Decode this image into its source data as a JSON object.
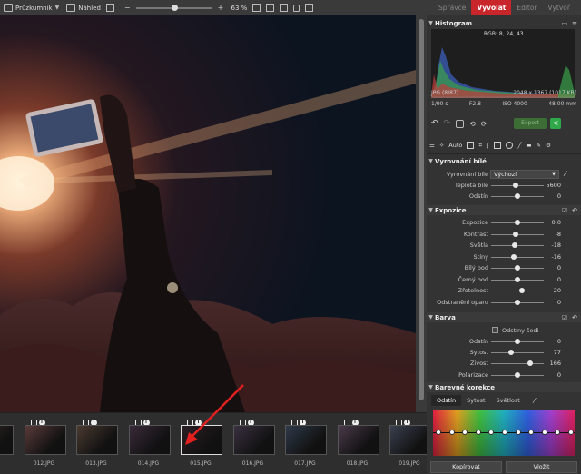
{
  "toolbar": {
    "browser_label": "Průzkumník",
    "preview_label": "Náhled",
    "zoom": "63 %",
    "zoom_slider": 0.5
  },
  "tabs": [
    {
      "label": "Správce",
      "active": false
    },
    {
      "label": "Vyvolat",
      "active": true
    },
    {
      "label": "Editor",
      "active": false
    },
    {
      "label": "Vytvoř",
      "active": false
    }
  ],
  "histogram": {
    "title": "Histogram",
    "rgb": "RGB: 8, 24, 43",
    "format_index": "JPG  (8/87)",
    "dimensions": "2048 x 1367 (1017 KB)",
    "shutter": "1/90 s",
    "aperture": "F2.8",
    "iso": "ISO 4000",
    "focal": "48.00 mm"
  },
  "export_label": "Export",
  "icon_row": {
    "auto_label": "Auto"
  },
  "white_balance": {
    "title": "Vyrovnání bílé",
    "rows": [
      {
        "label": "Vyrovnání bílé",
        "value": "Výchozí"
      },
      {
        "label": "Teplota bílé",
        "value": "5600",
        "level": 0.46
      },
      {
        "label": "Odstín",
        "value": "0",
        "level": 0.5
      }
    ]
  },
  "exposure": {
    "title": "Expozice",
    "rows": [
      {
        "label": "Expozice",
        "value": "0.0",
        "level": 0.5
      },
      {
        "label": "Kontrast",
        "value": "-8",
        "level": 0.46
      },
      {
        "label": "Světla",
        "value": "-18",
        "level": 0.44
      },
      {
        "label": "Stíny",
        "value": "-16",
        "level": 0.43
      },
      {
        "label": "Bílý bod",
        "value": "0",
        "level": 0.5
      },
      {
        "label": "Černý bod",
        "value": "0",
        "level": 0.5
      },
      {
        "label": "Zřetelnost",
        "value": "20",
        "level": 0.58
      },
      {
        "label": "Odstranění oparu",
        "value": "0",
        "level": 0.5
      }
    ]
  },
  "color": {
    "title": "Barva",
    "grayscale_label": "Odstíny šedi",
    "rows": [
      {
        "label": "Odstín",
        "value": "0",
        "level": 0.5
      },
      {
        "label": "Sytost",
        "value": "77",
        "level": 0.38
      },
      {
        "label": "Živost",
        "value": "166",
        "level": 0.74
      },
      {
        "label": "Polarizace",
        "value": "0",
        "level": 0.5
      }
    ]
  },
  "color_correction": {
    "title": "Barevné korekce",
    "tabs": [
      {
        "label": "Odstín",
        "active": true
      },
      {
        "label": "Sytost",
        "active": false
      },
      {
        "label": "Světlost",
        "active": false
      }
    ]
  },
  "bottom": {
    "copy_label": "Kopírovat",
    "paste_label": "Vložit"
  },
  "filmstrip": [
    {
      "label": ""
    },
    {
      "label": "012.JPG"
    },
    {
      "label": "013.JPG"
    },
    {
      "label": "014.JPG"
    },
    {
      "label": "015.JPG",
      "selected": true
    },
    {
      "label": "016.JPG"
    },
    {
      "label": "017.JPG"
    },
    {
      "label": "018.JPG"
    },
    {
      "label": "019.JPG"
    }
  ],
  "colors": {
    "accent": "#c9262b",
    "share": "#2fa84a"
  }
}
